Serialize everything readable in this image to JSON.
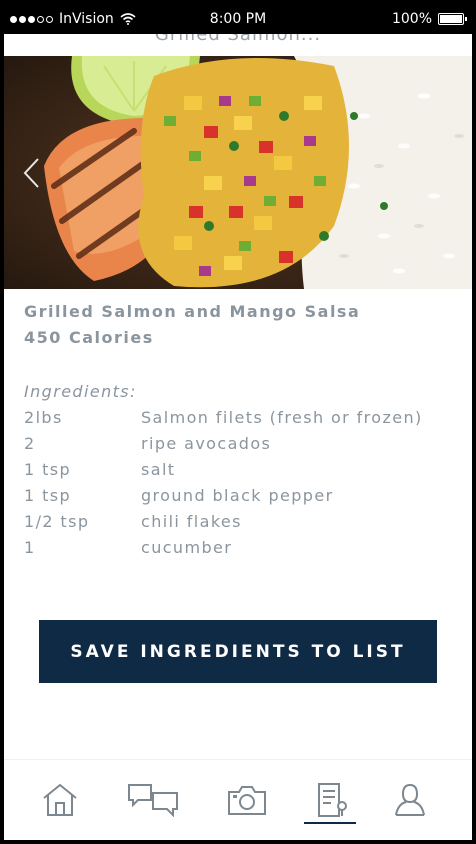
{
  "status_bar": {
    "carrier": "InVision",
    "time": "8:00 PM",
    "battery": "100%"
  },
  "header": {
    "title": "Grilled Salmon..."
  },
  "recipe": {
    "title": "Grilled Salmon and Mango Salsa",
    "calories": "450 Calories",
    "ingredients_heading": "Ingredients:",
    "ingredients": [
      {
        "qty": "2lbs",
        "name": "Salmon filets (fresh or frozen)"
      },
      {
        "qty": "2",
        "name": "ripe avocados"
      },
      {
        "qty": "1 tsp",
        "name": "salt"
      },
      {
        "qty": "1 tsp",
        "name": "ground black pepper"
      },
      {
        "qty": "1/2 tsp",
        "name": "chili flakes"
      },
      {
        "qty": "1",
        "name": "cucumber"
      }
    ]
  },
  "actions": {
    "save_label": "SAVE INGREDIENTS TO LIST"
  },
  "tabbar": {
    "items": [
      {
        "icon": "home-icon"
      },
      {
        "icon": "chat-icon"
      },
      {
        "icon": "camera-icon"
      },
      {
        "icon": "recipe-list-icon",
        "active": true
      },
      {
        "icon": "profile-icon"
      }
    ]
  },
  "colors": {
    "accent": "#0f2a44",
    "text_muted": "#8b959e",
    "icon": "#7d8790"
  }
}
